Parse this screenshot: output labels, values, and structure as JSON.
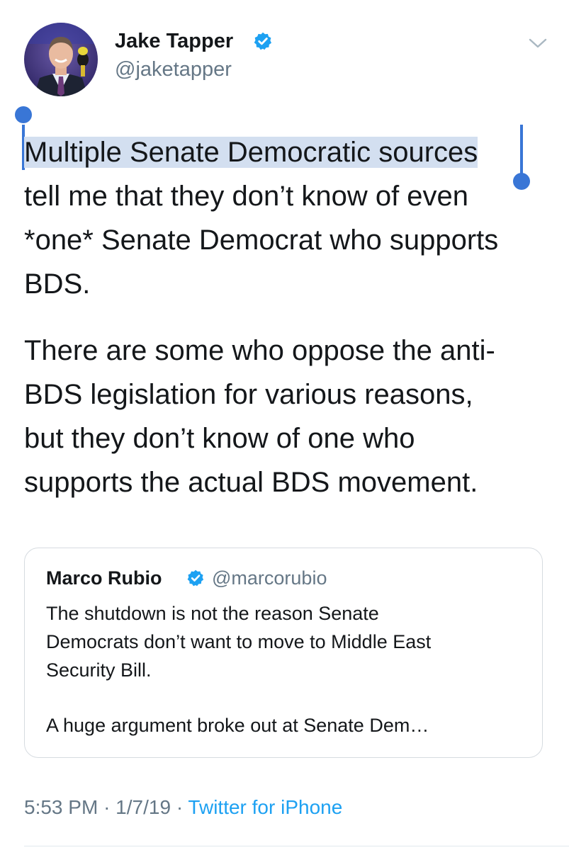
{
  "author": {
    "name": "Jake Tapper",
    "handle": "@jaketapper",
    "verified": true
  },
  "menu": {
    "icon": "chevron-down-icon"
  },
  "tweet": {
    "lines_p1": [
      "Multiple Senate Democratic sources",
      "tell me that they don’t know of even",
      "*one* Senate Democrat who supports",
      "BDS."
    ],
    "lines_p2": [
      "There are some who oppose the anti-",
      "BDS legislation for various reasons,",
      "but they don’t know of one who",
      "supports the actual BDS movement."
    ],
    "selected_text": "Multiple Senate Democratic sources"
  },
  "quote": {
    "name": "Marco Rubio",
    "handle": "@marcorubio",
    "verified": true,
    "lines_p1": [
      "The shutdown is not the reason Senate",
      "Democrats don’t want to move to Middle East",
      "Security Bill."
    ],
    "lines_p2": [
      "A huge argument broke out at Senate Dem…"
    ]
  },
  "meta": {
    "time": "5:53 PM",
    "separator": "·",
    "date": "1/7/19",
    "source": "Twitter for iPhone"
  },
  "colors": {
    "verified_blue": "#1da1f2",
    "selection_handle": "#3976d6",
    "selection_highlight": "#d3dff0",
    "secondary_text": "#657786"
  }
}
